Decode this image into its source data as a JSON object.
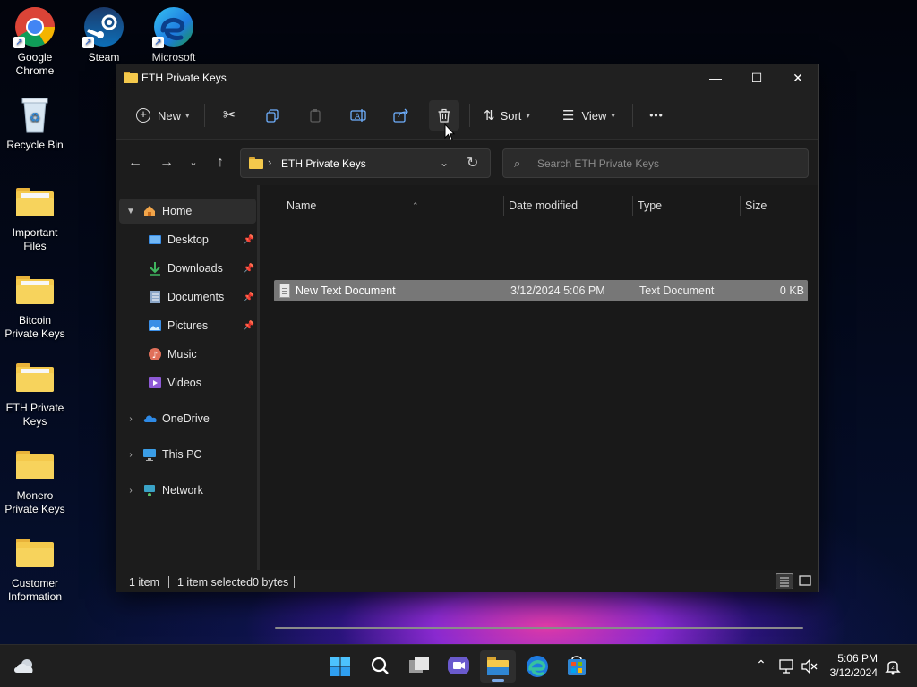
{
  "desktop": {
    "icons": [
      {
        "label_line1": "Google",
        "label_line2": "Chrome"
      },
      {
        "label_line1": "Steam",
        "label_line2": ""
      },
      {
        "label_line1": "Microsoft",
        "label_line2": ""
      },
      {
        "label_line1": "Recycle Bin",
        "label_line2": ""
      },
      {
        "label_line1": "Important",
        "label_line2": "Files"
      },
      {
        "label_line1": "Bitcoin",
        "label_line2": "Private Keys"
      },
      {
        "label_line1": "ETH Private",
        "label_line2": "Keys"
      },
      {
        "label_line1": "Monero",
        "label_line2": "Private Keys"
      },
      {
        "label_line1": "Customer",
        "label_line2": "Information"
      }
    ]
  },
  "window": {
    "title": "ETH Private Keys",
    "controls": {
      "minimize": "—",
      "maximize": "☐",
      "close": "✕"
    }
  },
  "toolbar": {
    "new_label": "New",
    "sort_label": "Sort",
    "view_label": "View",
    "more_label": "•••"
  },
  "address": {
    "path": "ETH Private Keys",
    "search_placeholder": "Search ETH Private Keys"
  },
  "nav": {
    "home": "Home",
    "desktop": "Desktop",
    "downloads": "Downloads",
    "documents": "Documents",
    "pictures": "Pictures",
    "music": "Music",
    "videos": "Videos",
    "onedrive": "OneDrive",
    "thispc": "This PC",
    "network": "Network"
  },
  "columns": {
    "name": "Name",
    "date": "Date modified",
    "type": "Type",
    "size": "Size"
  },
  "files": [
    {
      "name": "New Text Document",
      "date": "3/12/2024 5:06 PM",
      "type": "Text Document",
      "size": "0 KB"
    }
  ],
  "status": {
    "count": "1 item",
    "selected": "1 item selected",
    "bytes": "0 bytes"
  },
  "tray": {
    "time": "5:06 PM",
    "date": "3/12/2024"
  },
  "colors": {
    "accent": "#7aa8e6",
    "folder": "#f4c94c",
    "selection": "#777777"
  }
}
